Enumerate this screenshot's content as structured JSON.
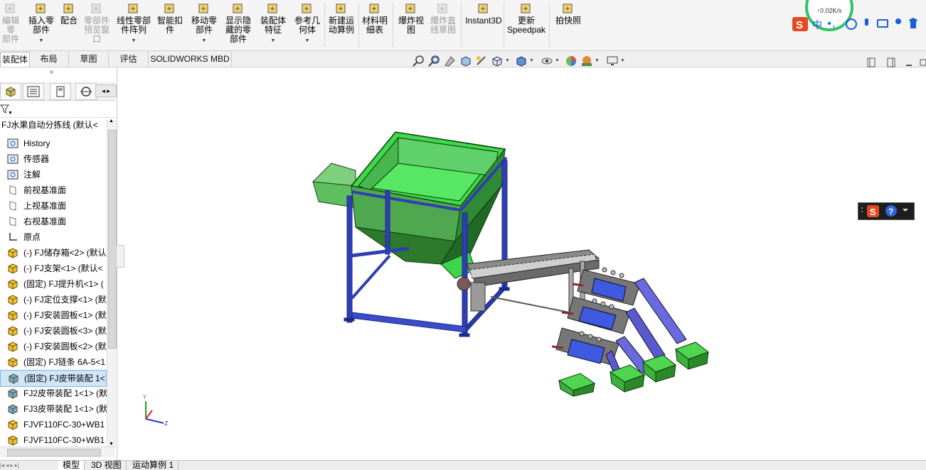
{
  "ribbon": {
    "buttons": [
      {
        "label": "编辑零\n部件",
        "icon": "edit-component-icon",
        "disabled": true,
        "arrow": false
      },
      {
        "label": "插入零\n部件",
        "icon": "insert-component-icon",
        "disabled": false,
        "arrow": true
      },
      {
        "label": "配合",
        "icon": "mate-paperclip-icon",
        "disabled": false,
        "arrow": false
      },
      {
        "label": "零部件\n预览窗\n口",
        "icon": "component-preview-icon",
        "disabled": true,
        "arrow": false
      },
      {
        "label": "线性零部\n件阵列",
        "icon": "linear-pattern-icon",
        "disabled": false,
        "arrow": true
      },
      {
        "label": "智能扣\n件",
        "icon": "smart-fastener-icon",
        "disabled": false,
        "arrow": false
      },
      {
        "label": "移动零\n部件",
        "icon": "move-component-icon",
        "disabled": false,
        "arrow": true
      },
      {
        "label": "显示隐\n藏的零\n部件",
        "icon": "show-hidden-icon",
        "disabled": false,
        "arrow": false
      },
      {
        "label": "装配体\n特征",
        "icon": "assembly-feature-icon",
        "disabled": false,
        "arrow": true
      },
      {
        "label": "参考几\n何体",
        "icon": "reference-geometry-icon",
        "disabled": false,
        "arrow": true
      },
      {
        "label": "新建运\n动算例",
        "icon": "motion-study-icon",
        "disabled": false,
        "arrow": false
      },
      {
        "label": "材料明\n细表",
        "icon": "bom-icon",
        "disabled": false,
        "arrow": false
      },
      {
        "label": "爆炸视\n图",
        "icon": "exploded-view-icon",
        "disabled": false,
        "arrow": false
      },
      {
        "label": "爆炸直\n线草图",
        "icon": "explode-line-sketch-icon",
        "disabled": true,
        "arrow": false
      },
      {
        "label": "Instant3D",
        "icon": "instant3d-icon",
        "disabled": false,
        "arrow": false
      },
      {
        "label": "更新\nSpeedpak",
        "icon": "speedpak-icon",
        "disabled": false,
        "arrow": false
      },
      {
        "label": "拍快照",
        "icon": "camera-icon",
        "disabled": false,
        "arrow": false
      }
    ]
  },
  "tray": {
    "net_speed": "↑0.02K/s",
    "ime_label": "中"
  },
  "command_tabs": [
    "装配体",
    "布局",
    "草图",
    "评估",
    "SOLIDWORKS MBD"
  ],
  "feature_tree": {
    "root": "FJ水果自动分拣线 (默认<",
    "nodes": [
      {
        "label": "History",
        "icon": "history-icon"
      },
      {
        "label": "传感器",
        "icon": "sensor-icon"
      },
      {
        "label": "注解",
        "icon": "annotation-icon"
      },
      {
        "label": "前视基准面",
        "icon": "plane-icon"
      },
      {
        "label": "上视基准面",
        "icon": "plane-icon"
      },
      {
        "label": "右视基准面",
        "icon": "plane-icon"
      },
      {
        "label": "原点",
        "icon": "origin-icon"
      },
      {
        "label": "(-) FJ储存箱<2> (默认",
        "icon": "part-icon"
      },
      {
        "label": "(-) FJ支架<1> (默认<",
        "icon": "part-icon"
      },
      {
        "label": "(固定) FJ提升机<1> (",
        "icon": "part-icon"
      },
      {
        "label": "(-) FJ定位支撑<1> (默",
        "icon": "part-icon"
      },
      {
        "label": "(-) FJ安装圆板<1> (默",
        "icon": "part-icon"
      },
      {
        "label": "(-) FJ安装圆板<3> (默",
        "icon": "part-icon"
      },
      {
        "label": "(-) FJ安装圆板<2> (默",
        "icon": "part-icon"
      },
      {
        "label": "(固定) FJ链条 6A-5<1",
        "icon": "part-icon"
      },
      {
        "label": "(固定) FJ皮带装配 1<",
        "icon": "subassembly-icon",
        "selected": true
      },
      {
        "label": "FJ2皮带装配 1<1> (默",
        "icon": "subassembly-icon"
      },
      {
        "label": "FJ3皮带装配 1<1> (默",
        "icon": "subassembly-icon"
      },
      {
        "label": "FJVF110FC-30+WB1",
        "icon": "part-icon"
      },
      {
        "label": "FJVF110FC-30+WB1",
        "icon": "part-icon"
      }
    ]
  },
  "bottom_tabs": [
    "模型",
    "3D 视图",
    "运动算例 1"
  ],
  "colors": {
    "hopper_green": "#4fc45a",
    "frame_blue": "#2f3fb0",
    "chute_blue": "#3d5ae0",
    "bin_green": "#3db03d",
    "selection": "#cfe5fa"
  }
}
